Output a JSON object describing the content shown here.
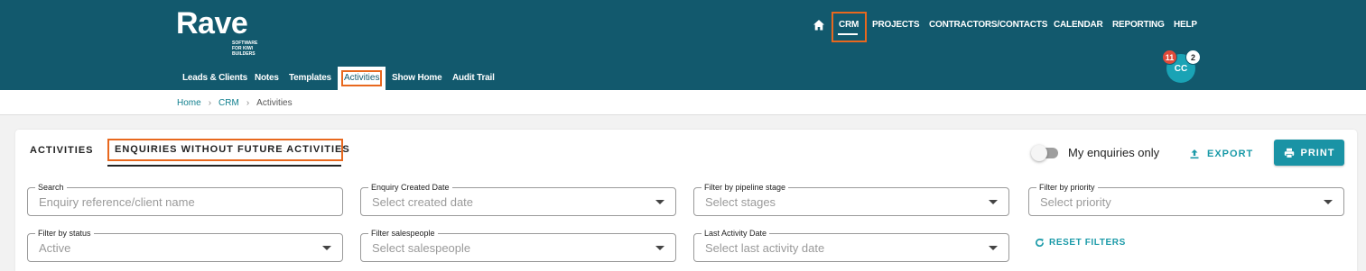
{
  "brand": {
    "name": "Rave",
    "tagline": "SOFTWARE FOR KIWI BUILDERS"
  },
  "topnav": {
    "home_icon": "home-icon",
    "items": [
      "CRM",
      "PROJECTS",
      "CONTRACTORS/CONTACTS",
      "CALENDAR",
      "REPORTING",
      "HELP"
    ],
    "active": "CRM"
  },
  "subnav": {
    "items": [
      "Leads & Clients",
      "Notes",
      "Templates",
      "Activities",
      "Show Home",
      "Audit Trail"
    ],
    "active": "Activities"
  },
  "user": {
    "initials": "CC",
    "notification_count": "11",
    "message_count": "2"
  },
  "breadcrumb": {
    "items": [
      "Home",
      "CRM",
      "Activities"
    ],
    "separator": "›"
  },
  "tabs": {
    "items": [
      "ACTIVITIES",
      "ENQUIRIES WITHOUT FUTURE ACTIVITIES"
    ],
    "active": "ENQUIRIES WITHOUT FUTURE ACTIVITIES"
  },
  "toolbar": {
    "my_enquiries_label": "My enquiries only",
    "my_enquiries_on": false,
    "export_label": "EXPORT",
    "print_label": "PRINT"
  },
  "filters": {
    "search": {
      "label": "Search",
      "placeholder": "Enquiry reference/client name"
    },
    "created_date": {
      "label": "Enquiry Created Date",
      "placeholder": "Select created date"
    },
    "pipeline_stage": {
      "label": "Filter by pipeline stage",
      "placeholder": "Select stages"
    },
    "priority": {
      "label": "Filter by priority",
      "placeholder": "Select priority"
    },
    "status": {
      "label": "Filter by status",
      "value": "Active"
    },
    "salespeople": {
      "label": "Filter salespeople",
      "placeholder": "Select salespeople"
    },
    "last_activity": {
      "label": "Last Activity Date",
      "placeholder": "Select last activity date"
    },
    "reset_label": "RESET FILTERS"
  },
  "colors": {
    "header_bg": "#12596d",
    "accent": "#1a93a5",
    "highlight": "#e8681e"
  }
}
